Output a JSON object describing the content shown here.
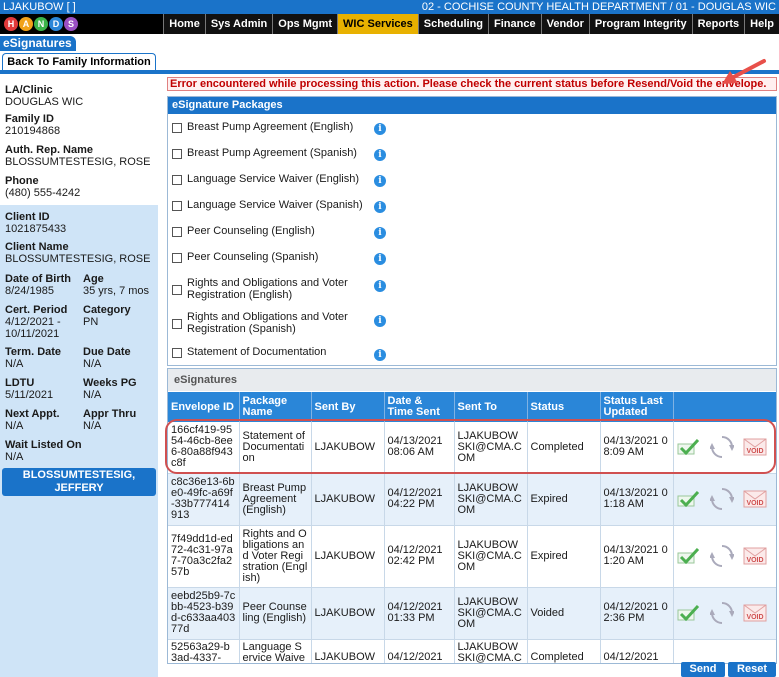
{
  "titlebar": {
    "left": "LJAKUBOW [ ]",
    "right": "02 - COCHISE COUNTY HEALTH DEPARTMENT / 01 - DOUGLAS WIC"
  },
  "logo": {
    "letters": [
      "H",
      "A",
      "N",
      "D",
      "S"
    ]
  },
  "nav": [
    "Home",
    "Sys Admin",
    "Ops Mgmt",
    "WIC Services",
    "Scheduling",
    "Finance",
    "Vendor",
    "Program Integrity",
    "Reports",
    "Help"
  ],
  "nav_active": "WIC Services",
  "page": {
    "section_title": "eSignatures",
    "back_button": "Back To Family Information",
    "error": "Error encountered while processing this action. Please check the current status before Resend/Void the envelope."
  },
  "family": {
    "la_clinic_label": "LA/Clinic",
    "la_clinic": "DOUGLAS WIC",
    "family_id_label": "Family ID",
    "family_id": "210194868",
    "auth_rep_label": "Auth. Rep. Name",
    "auth_rep": "BLOSSUMTESTESIG, ROSE",
    "phone_label": "Phone",
    "phone": "(480) 555-4242"
  },
  "client": {
    "client_id_label": "Client ID",
    "client_id": "1021875433",
    "client_name_label": "Client Name",
    "client_name": "BLOSSUMTESTESIG, ROSE",
    "dob_label": "Date of Birth",
    "dob": "8/24/1985",
    "age_label": "Age",
    "age": "35 yrs, 7 mos",
    "cert_label": "Cert. Period",
    "cert": "4/12/2021 - 10/11/2021",
    "category_label": "Category",
    "category": "PN",
    "term_label": "Term. Date",
    "term": "N/A",
    "due_label": "Due Date",
    "due": "N/A",
    "ldtu_label": "LDTU",
    "ldtu": "5/11/2021",
    "weeks_label": "Weeks PG",
    "weeks": "N/A",
    "next_label": "Next Appt.",
    "next": "N/A",
    "appr_label": "Appr Thru",
    "appr": "N/A",
    "wait_label": "Wait Listed On",
    "wait": "N/A",
    "person_button": "BLOSSUMTESTESIG, JEFFERY"
  },
  "packages": {
    "header": "eSignature Packages",
    "items": [
      "Breast Pump Agreement (English)",
      "Breast Pump Agreement (Spanish)",
      "Language Service Waiver (English)",
      "Language Service Waiver (Spanish)",
      "Peer Counseling (English)",
      "Peer Counseling (Spanish)",
      "Rights and Obligations and Voter Registration (English)",
      "Rights and Obligations and Voter Registration (Spanish)",
      "Statement of Documentation"
    ]
  },
  "esignatures": {
    "header": "eSignatures",
    "columns": [
      "Envelope ID",
      "Package Name",
      "Sent By",
      "Date & Time Sent",
      "Sent To",
      "Status",
      "Status Last Updated",
      ""
    ],
    "rows": [
      {
        "envelope": "166cf419-9554-46cb-8ee6-80a88f943c8f",
        "package": "Statement of Documentation",
        "sent_by": "LJAKUBOW",
        "sent": "04/13/2021 08:06 AM",
        "sent_to": "LJAKUBOWSKI@CMA.COM",
        "status": "Completed",
        "updated": "04/13/2021 08:09 AM"
      },
      {
        "envelope": "c8c36e13-6be0-49fc-a69f-33b777414913",
        "package": "Breast Pump Agreement (English)",
        "sent_by": "LJAKUBOW",
        "sent": "04/12/2021 04:22 PM",
        "sent_to": "LJAKUBOWSKI@CMA.COM",
        "status": "Expired",
        "updated": "04/13/2021 01:18 AM"
      },
      {
        "envelope": "7f49dd1d-ed72-4c31-97a7-70a3c2fa257b",
        "package": "Rights and Obligations and Voter Registration (English)",
        "sent_by": "LJAKUBOW",
        "sent": "04/12/2021 02:42 PM",
        "sent_to": "LJAKUBOWSKI@CMA.COM",
        "status": "Expired",
        "updated": "04/13/2021 01:20 AM"
      },
      {
        "envelope": "eebd25b9-7cbb-4523-b39d-c633aa40377d",
        "package": "Peer Counseling (English)",
        "sent_by": "LJAKUBOW",
        "sent": "04/12/2021 01:33 PM",
        "sent_to": "LJAKUBOWSKI@CMA.COM",
        "status": "Voided",
        "updated": "04/12/2021 02:36 PM"
      },
      {
        "envelope": "52563a29-b3ad-4337-",
        "package": "Language Service Waiver",
        "sent_by": "LJAKUBOW",
        "sent": "04/12/2021",
        "sent_to": "LJAKUBOWSKI@CMA.COM",
        "status": "Completed",
        "updated": "04/12/2021"
      }
    ]
  },
  "buttons": {
    "send": "Send",
    "reset": "Reset"
  },
  "colors": {
    "primary": "#1a73c9",
    "active_nav": "#e8b100",
    "error": "#c00000",
    "highlight": "#d05050"
  }
}
